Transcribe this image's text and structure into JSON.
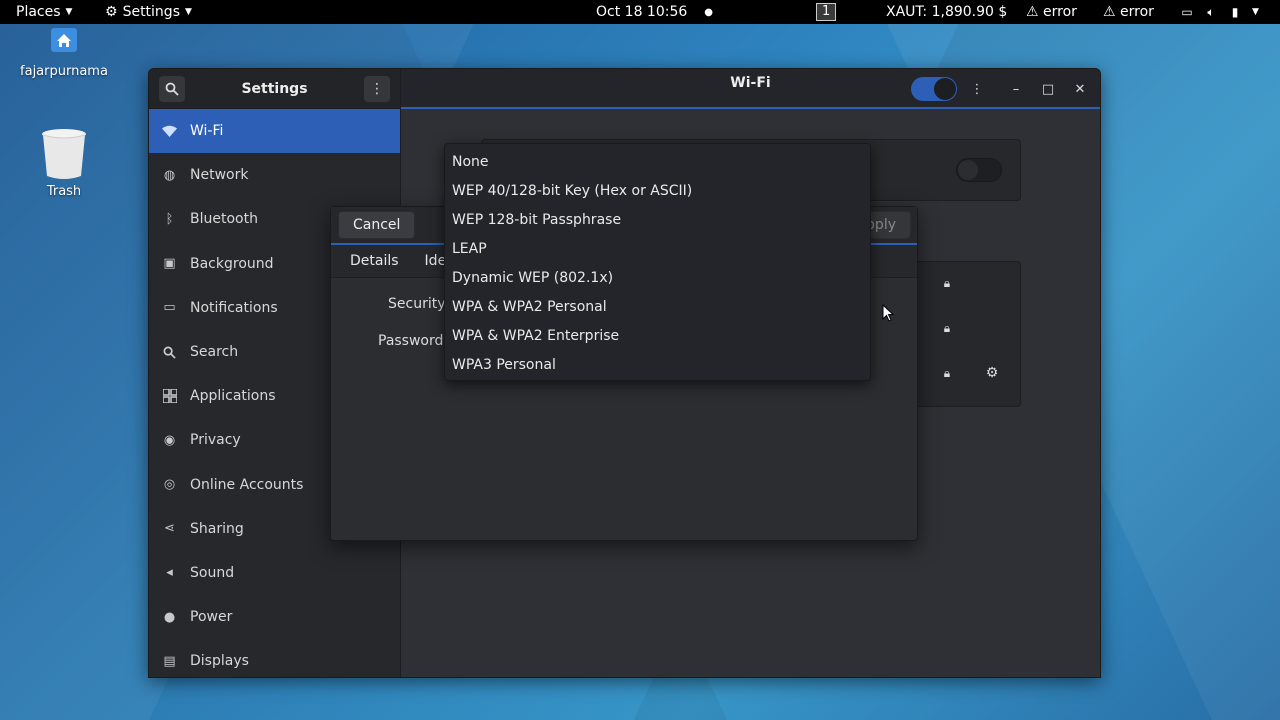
{
  "topbar": {
    "places": "Places",
    "settings": "Settings",
    "datetime": "Oct 18  10:56",
    "workspace": "1",
    "ticker": "XAUT: 1,890.90 $",
    "error1": "⚠ error",
    "error2": "⚠ error"
  },
  "desktop": {
    "home_label": "fajarpurnama",
    "trash_label": "Trash"
  },
  "sidebar": {
    "title": "Settings",
    "items": [
      {
        "label": "Wi-Fi",
        "icon": "wifi-icon"
      },
      {
        "label": "Network",
        "icon": "network-icon"
      },
      {
        "label": "Bluetooth",
        "icon": "bluetooth-icon"
      },
      {
        "label": "Background",
        "icon": "background-icon"
      },
      {
        "label": "Notifications",
        "icon": "notifications-icon"
      },
      {
        "label": "Search",
        "icon": "search-icon"
      },
      {
        "label": "Applications",
        "icon": "applications-icon"
      },
      {
        "label": "Privacy",
        "icon": "privacy-icon"
      },
      {
        "label": "Online Accounts",
        "icon": "online-accounts-icon"
      },
      {
        "label": "Sharing",
        "icon": "sharing-icon"
      },
      {
        "label": "Sound",
        "icon": "sound-icon"
      },
      {
        "label": "Power",
        "icon": "power-icon"
      },
      {
        "label": "Displays",
        "icon": "displays-icon"
      }
    ]
  },
  "main": {
    "title": "Wi-Fi"
  },
  "dialog": {
    "cancel": "Cancel",
    "apply": "pply",
    "tabs": [
      "Details",
      "Ide"
    ],
    "security_label": "Security",
    "password_label": "Password"
  },
  "dropdown": {
    "options": [
      "None",
      "WEP 40/128-bit Key (Hex or ASCII)",
      "WEP 128-bit Passphrase",
      "LEAP",
      "Dynamic WEP (802.1x)",
      "WPA & WPA2 Personal",
      "WPA & WPA2 Enterprise",
      "WPA3 Personal"
    ]
  },
  "colors": {
    "accent": "#2d5fb7",
    "window_bg": "#2b2d31",
    "topbar": "#000000"
  }
}
